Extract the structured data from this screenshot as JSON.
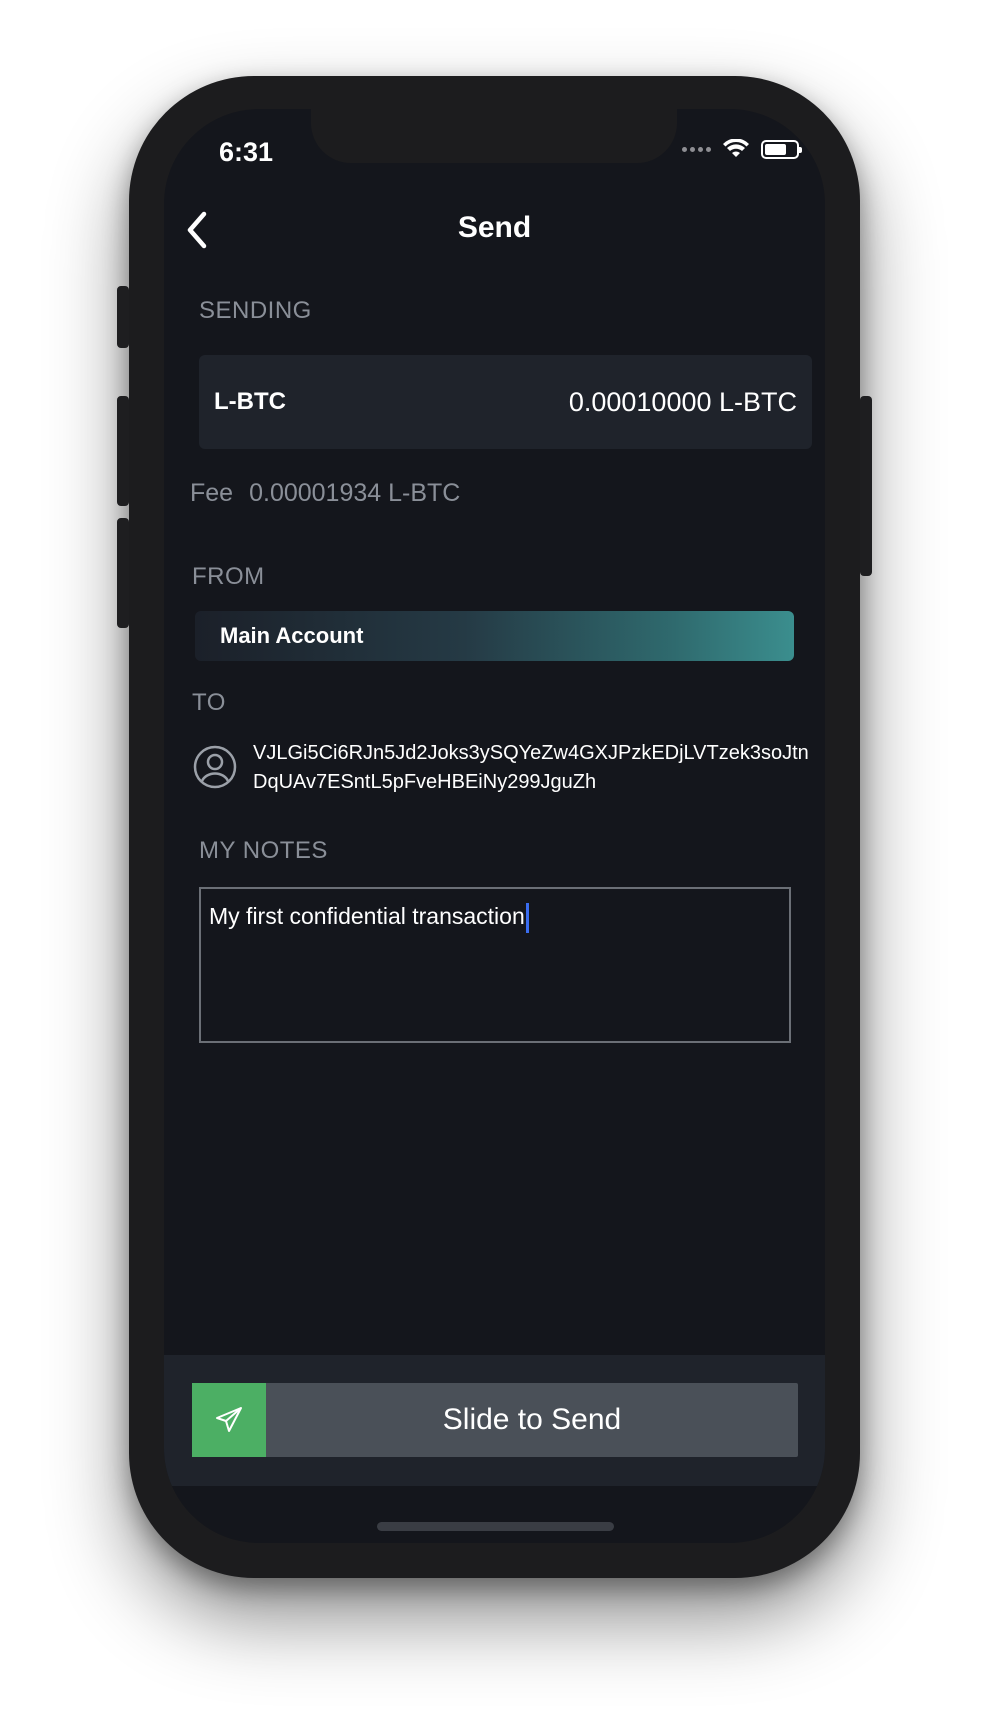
{
  "status_bar": {
    "time": "6:31"
  },
  "nav": {
    "title": "Send"
  },
  "sending": {
    "label": "SENDING",
    "asset": "L-BTC",
    "amount": "0.00010000 L-BTC",
    "fee_label": "Fee",
    "fee_value": "0.00001934 L-BTC"
  },
  "from": {
    "label": "FROM",
    "account": "Main Account"
  },
  "to": {
    "label": "TO",
    "address": "VJLGi5Ci6RJn5Jd2Joks3ySQYeZw4GXJPzkEDjLVTzek3soJtnDqUAv7ESntL5pFveHBEiNy299JguZh"
  },
  "notes": {
    "label": "MY NOTES",
    "value": "My first confidential transaction"
  },
  "slider": {
    "label": "Slide to Send"
  },
  "colors": {
    "background": "#14161c",
    "card": "#1f232b",
    "accent_green": "#4caf64",
    "gradient_end": "#3b8e8e",
    "caret": "#3a6df0"
  },
  "icons": [
    "back-chevron-icon",
    "wifi-icon",
    "battery-icon",
    "contact-avatar-icon",
    "paper-plane-icon"
  ]
}
